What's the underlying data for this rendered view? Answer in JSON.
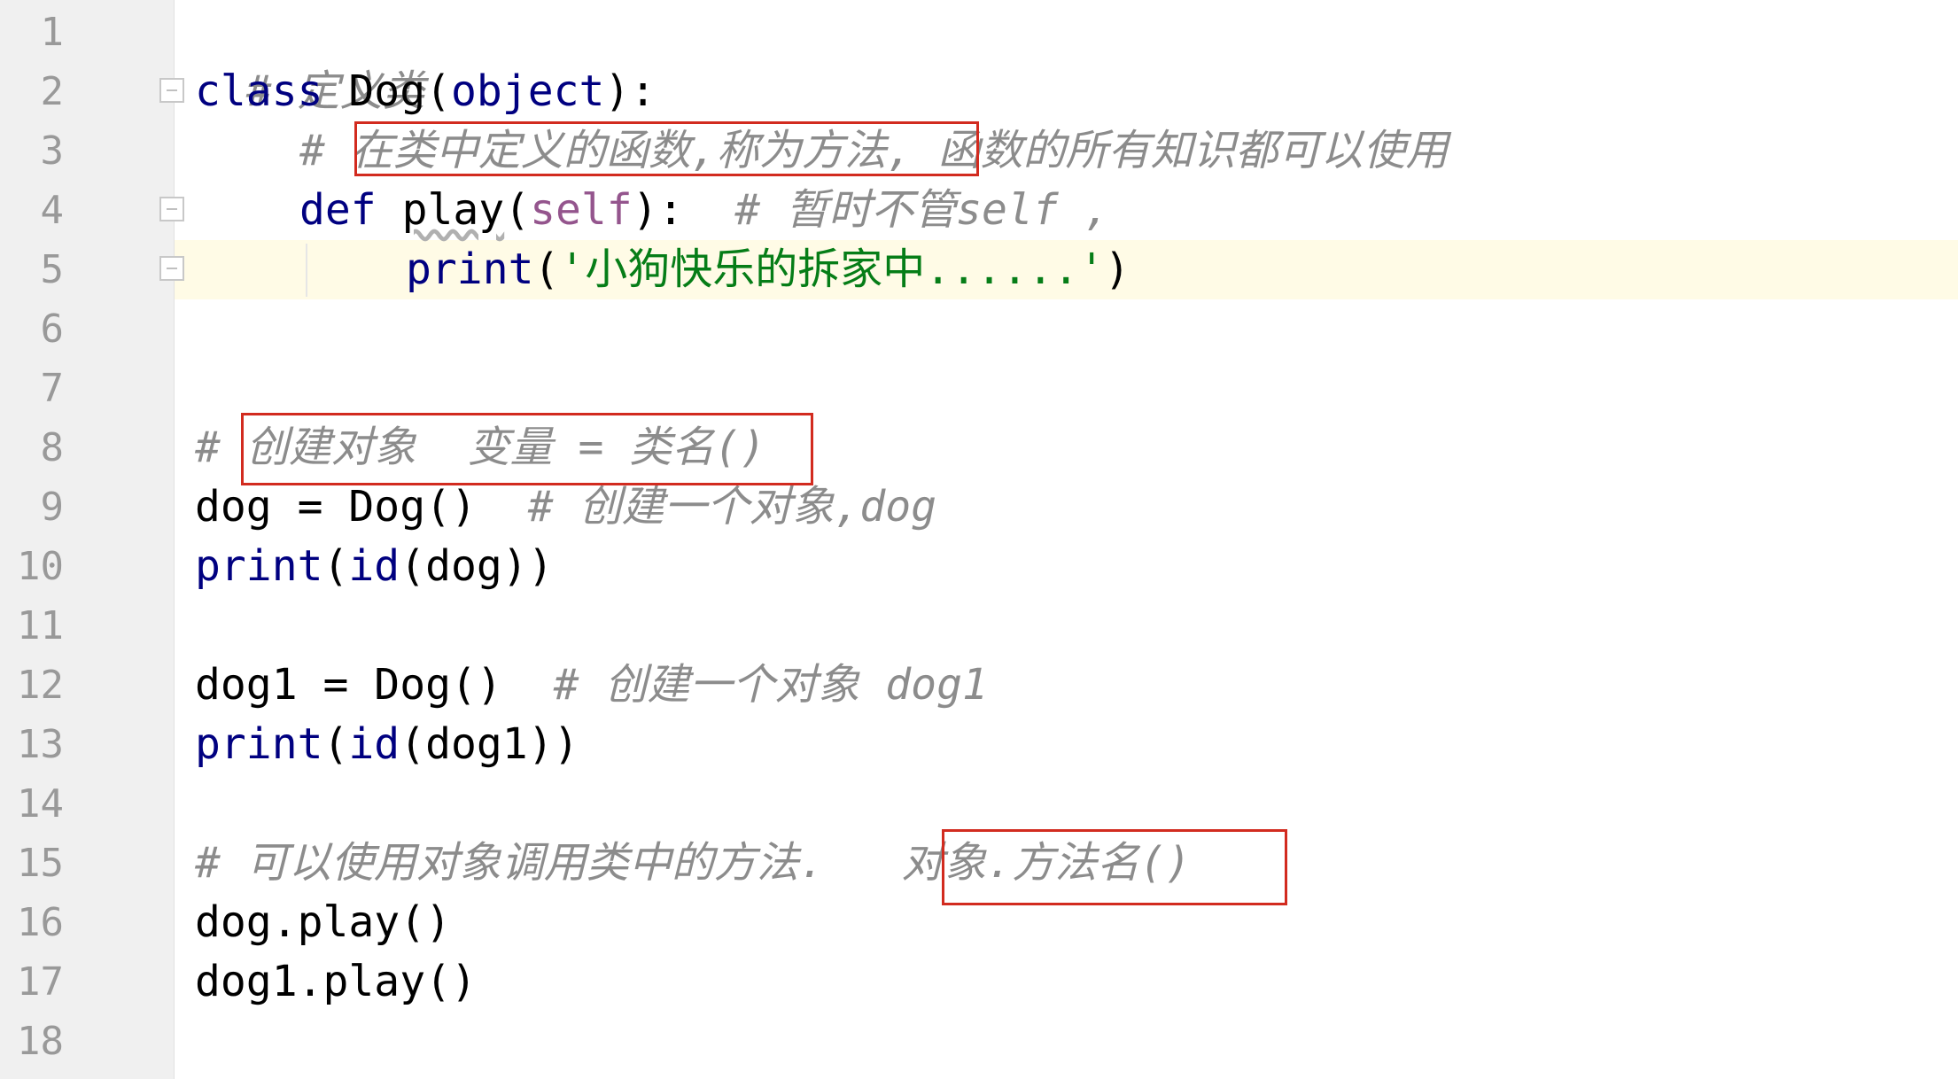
{
  "editor": {
    "line_numbers": [
      "1",
      "2",
      "3",
      "4",
      "5",
      "6",
      "7",
      "8",
      "9",
      "10",
      "11",
      "12",
      "13",
      "14",
      "15",
      "16",
      "17",
      "18"
    ],
    "lines": {
      "l1": {
        "comment": "# 定义类"
      },
      "l2": {
        "kw": "class",
        "rest": " Dog(",
        "obj": "object",
        "tail": "):"
      },
      "l3": {
        "hash": "# ",
        "boxed": "在类中定义的函数,称为方法,",
        "rest": " 函数的所有知识都可以使用"
      },
      "l4": {
        "kw": "def",
        "sp": " ",
        "fn": "play",
        "open": "(",
        "self": "self",
        "close": "):",
        "comment": "  # 暂时不管self ,"
      },
      "l5": {
        "fn": "print",
        "open": "(",
        "str": "'小狗快乐的拆家中......'",
        "close": ")"
      },
      "l8": {
        "hash": "# ",
        "boxed": "创建对象  变量 = 类名()"
      },
      "l9": {
        "code": "dog = Dog()",
        "comment": "  # 创建一个对象,dog"
      },
      "l10": {
        "fn": "print",
        "open": "(",
        "fn2": "id",
        "rest": "(dog))"
      },
      "l12": {
        "code": "dog1 = Dog()",
        "comment": "  # 创建一个对象 dog1"
      },
      "l13": {
        "fn": "print",
        "open": "(",
        "fn2": "id",
        "rest": "(dog1))"
      },
      "l15": {
        "comment": "# 可以使用对象调用类中的方法.   ",
        "boxed": "对象.方法名()"
      },
      "l16": {
        "code": "dog.play()"
      },
      "l17": {
        "code": "dog1.play()"
      }
    }
  },
  "colors": {
    "keyword": "#000080",
    "comment": "#8c8c8c",
    "string": "#067d17",
    "self": "#94558d",
    "highlight_box": "#d22b1f",
    "current_line": "#fffbe6"
  }
}
